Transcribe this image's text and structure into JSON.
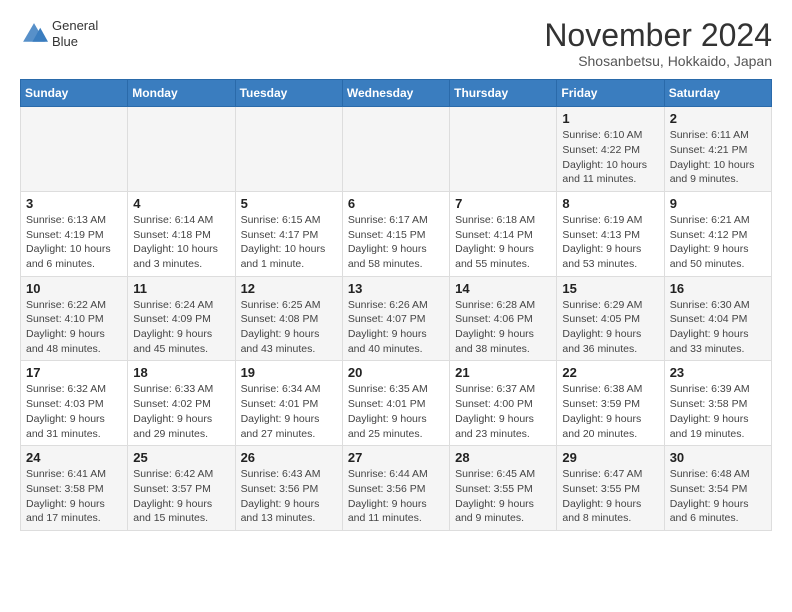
{
  "header": {
    "logo_line1": "General",
    "logo_line2": "Blue",
    "main_title": "November 2024",
    "subtitle": "Shosanbetsu, Hokkaido, Japan"
  },
  "days_of_week": [
    "Sunday",
    "Monday",
    "Tuesday",
    "Wednesday",
    "Thursday",
    "Friday",
    "Saturday"
  ],
  "weeks": [
    [
      {
        "day": "",
        "info": ""
      },
      {
        "day": "",
        "info": ""
      },
      {
        "day": "",
        "info": ""
      },
      {
        "day": "",
        "info": ""
      },
      {
        "day": "",
        "info": ""
      },
      {
        "day": "1",
        "info": "Sunrise: 6:10 AM\nSunset: 4:22 PM\nDaylight: 10 hours and 11 minutes."
      },
      {
        "day": "2",
        "info": "Sunrise: 6:11 AM\nSunset: 4:21 PM\nDaylight: 10 hours and 9 minutes."
      }
    ],
    [
      {
        "day": "3",
        "info": "Sunrise: 6:13 AM\nSunset: 4:19 PM\nDaylight: 10 hours and 6 minutes."
      },
      {
        "day": "4",
        "info": "Sunrise: 6:14 AM\nSunset: 4:18 PM\nDaylight: 10 hours and 3 minutes."
      },
      {
        "day": "5",
        "info": "Sunrise: 6:15 AM\nSunset: 4:17 PM\nDaylight: 10 hours and 1 minute."
      },
      {
        "day": "6",
        "info": "Sunrise: 6:17 AM\nSunset: 4:15 PM\nDaylight: 9 hours and 58 minutes."
      },
      {
        "day": "7",
        "info": "Sunrise: 6:18 AM\nSunset: 4:14 PM\nDaylight: 9 hours and 55 minutes."
      },
      {
        "day": "8",
        "info": "Sunrise: 6:19 AM\nSunset: 4:13 PM\nDaylight: 9 hours and 53 minutes."
      },
      {
        "day": "9",
        "info": "Sunrise: 6:21 AM\nSunset: 4:12 PM\nDaylight: 9 hours and 50 minutes."
      }
    ],
    [
      {
        "day": "10",
        "info": "Sunrise: 6:22 AM\nSunset: 4:10 PM\nDaylight: 9 hours and 48 minutes."
      },
      {
        "day": "11",
        "info": "Sunrise: 6:24 AM\nSunset: 4:09 PM\nDaylight: 9 hours and 45 minutes."
      },
      {
        "day": "12",
        "info": "Sunrise: 6:25 AM\nSunset: 4:08 PM\nDaylight: 9 hours and 43 minutes."
      },
      {
        "day": "13",
        "info": "Sunrise: 6:26 AM\nSunset: 4:07 PM\nDaylight: 9 hours and 40 minutes."
      },
      {
        "day": "14",
        "info": "Sunrise: 6:28 AM\nSunset: 4:06 PM\nDaylight: 9 hours and 38 minutes."
      },
      {
        "day": "15",
        "info": "Sunrise: 6:29 AM\nSunset: 4:05 PM\nDaylight: 9 hours and 36 minutes."
      },
      {
        "day": "16",
        "info": "Sunrise: 6:30 AM\nSunset: 4:04 PM\nDaylight: 9 hours and 33 minutes."
      }
    ],
    [
      {
        "day": "17",
        "info": "Sunrise: 6:32 AM\nSunset: 4:03 PM\nDaylight: 9 hours and 31 minutes."
      },
      {
        "day": "18",
        "info": "Sunrise: 6:33 AM\nSunset: 4:02 PM\nDaylight: 9 hours and 29 minutes."
      },
      {
        "day": "19",
        "info": "Sunrise: 6:34 AM\nSunset: 4:01 PM\nDaylight: 9 hours and 27 minutes."
      },
      {
        "day": "20",
        "info": "Sunrise: 6:35 AM\nSunset: 4:01 PM\nDaylight: 9 hours and 25 minutes."
      },
      {
        "day": "21",
        "info": "Sunrise: 6:37 AM\nSunset: 4:00 PM\nDaylight: 9 hours and 23 minutes."
      },
      {
        "day": "22",
        "info": "Sunrise: 6:38 AM\nSunset: 3:59 PM\nDaylight: 9 hours and 20 minutes."
      },
      {
        "day": "23",
        "info": "Sunrise: 6:39 AM\nSunset: 3:58 PM\nDaylight: 9 hours and 19 minutes."
      }
    ],
    [
      {
        "day": "24",
        "info": "Sunrise: 6:41 AM\nSunset: 3:58 PM\nDaylight: 9 hours and 17 minutes."
      },
      {
        "day": "25",
        "info": "Sunrise: 6:42 AM\nSunset: 3:57 PM\nDaylight: 9 hours and 15 minutes."
      },
      {
        "day": "26",
        "info": "Sunrise: 6:43 AM\nSunset: 3:56 PM\nDaylight: 9 hours and 13 minutes."
      },
      {
        "day": "27",
        "info": "Sunrise: 6:44 AM\nSunset: 3:56 PM\nDaylight: 9 hours and 11 minutes."
      },
      {
        "day": "28",
        "info": "Sunrise: 6:45 AM\nSunset: 3:55 PM\nDaylight: 9 hours and 9 minutes."
      },
      {
        "day": "29",
        "info": "Sunrise: 6:47 AM\nSunset: 3:55 PM\nDaylight: 9 hours and 8 minutes."
      },
      {
        "day": "30",
        "info": "Sunrise: 6:48 AM\nSunset: 3:54 PM\nDaylight: 9 hours and 6 minutes."
      }
    ]
  ]
}
